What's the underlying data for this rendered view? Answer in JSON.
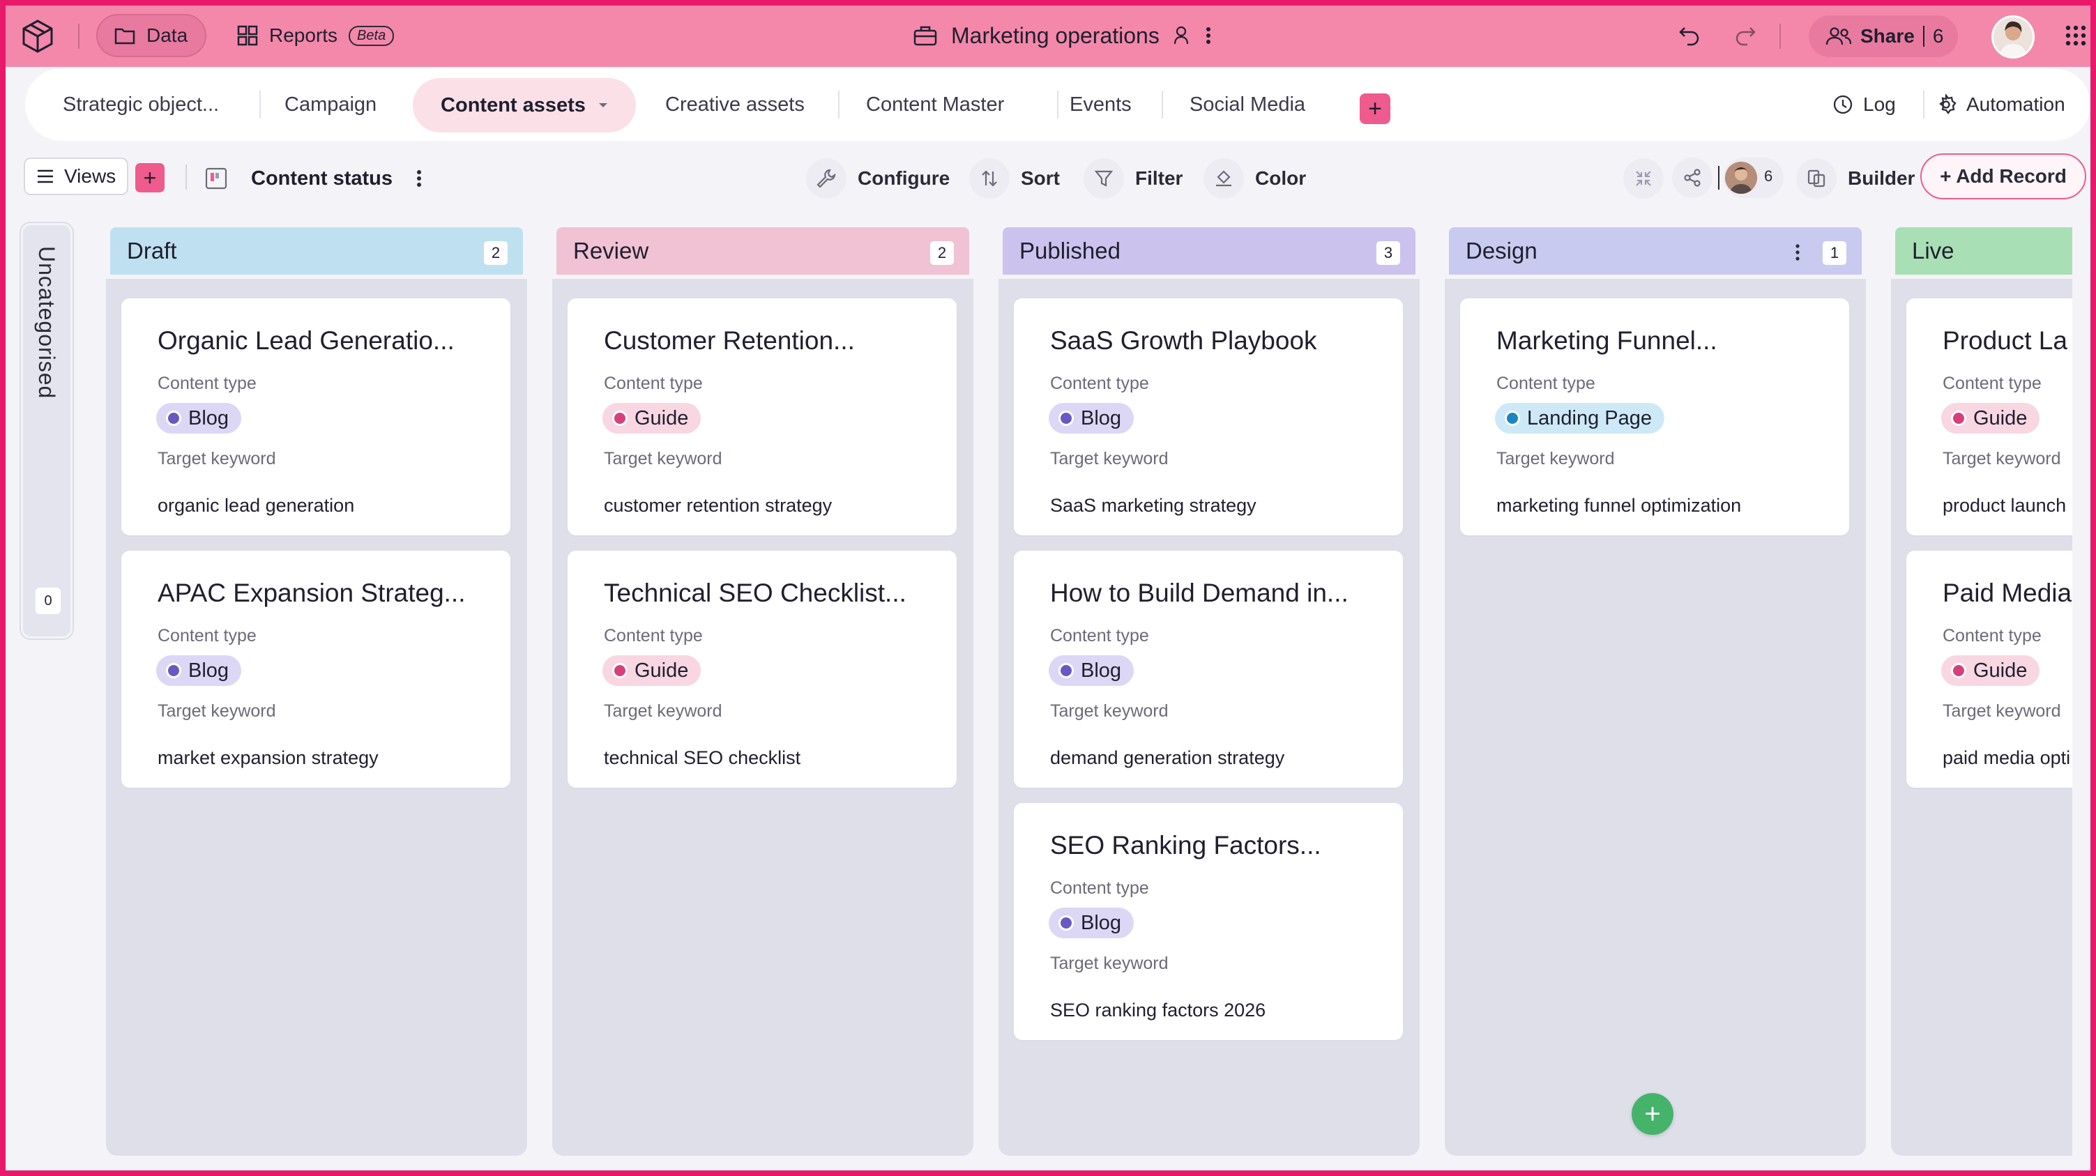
{
  "topbar": {
    "data_label": "Data",
    "reports_label": "Reports",
    "beta_label": "Beta",
    "title": "Marketing operations",
    "share_label": "Share",
    "share_count": "6"
  },
  "tabs": {
    "items": [
      "Strategic object...",
      "Campaign",
      "Content assets",
      "Creative assets",
      "Content Master",
      "Events",
      "Social Media"
    ],
    "active": "Content assets",
    "log_label": "Log",
    "automation_label": "Automation"
  },
  "toolbar": {
    "views_label": "Views",
    "view_name": "Content status",
    "configure_label": "Configure",
    "sort_label": "Sort",
    "filter_label": "Filter",
    "color_label": "Color",
    "collaborator_count": "6",
    "builder_label": "Builder",
    "add_record_label": "+ Add Record"
  },
  "uncategorised": {
    "label": "Uncategorised",
    "count": "0"
  },
  "colors": {
    "accent": "#ef5b8c",
    "topbar": "#f488aa",
    "frame": "#e8196a",
    "draft": "#bfe0f0",
    "review": "#f0c2d4",
    "published": "#cbc3ee",
    "design": "#c8caf0",
    "live": "#a9dfb4",
    "blog_pill": "#dcd7f5",
    "guide_pill": "#f8d6e2",
    "landing_pill": "#cde9f7"
  },
  "columns": [
    {
      "title": "Draft",
      "count": "2",
      "cards": [
        {
          "title": "Organic Lead Generatio...",
          "type_label": "Content type",
          "type": "Blog",
          "kw_label": "Target keyword",
          "keyword": "organic lead generation"
        },
        {
          "title": "APAC Expansion Strateg...",
          "type_label": "Content type",
          "type": "Blog",
          "kw_label": "Target keyword",
          "keyword": "market expansion strategy"
        }
      ]
    },
    {
      "title": "Review",
      "count": "2",
      "cards": [
        {
          "title": "Customer Retention...",
          "type_label": "Content type",
          "type": "Guide",
          "kw_label": "Target keyword",
          "keyword": "customer retention strategy"
        },
        {
          "title": "Technical SEO Checklist...",
          "type_label": "Content type",
          "type": "Guide",
          "kw_label": "Target keyword",
          "keyword": "technical SEO checklist"
        }
      ]
    },
    {
      "title": "Published",
      "count": "3",
      "cards": [
        {
          "title": "SaaS Growth Playbook",
          "type_label": "Content type",
          "type": "Blog",
          "kw_label": "Target keyword",
          "keyword": "SaaS marketing strategy"
        },
        {
          "title": "How to Build Demand in...",
          "type_label": "Content type",
          "type": "Blog",
          "kw_label": "Target keyword",
          "keyword": "demand generation strategy"
        },
        {
          "title": "SEO Ranking Factors...",
          "type_label": "Content type",
          "type": "Blog",
          "kw_label": "Target keyword",
          "keyword": "SEO ranking factors 2026"
        }
      ]
    },
    {
      "title": "Design",
      "count": "1",
      "cards": [
        {
          "title": "Marketing Funnel...",
          "type_label": "Content type",
          "type": "Landing Page",
          "kw_label": "Target keyword",
          "keyword": "marketing funnel optimization"
        }
      ]
    },
    {
      "title": "Live",
      "cards": [
        {
          "title": "Product La",
          "type_label": "Content type",
          "type": "Guide",
          "kw_label": "Target keyword",
          "keyword": "product launch"
        },
        {
          "title": "Paid Media",
          "type_label": "Content type",
          "type": "Guide",
          "kw_label": "Target keyword",
          "keyword": "paid media opti"
        }
      ]
    }
  ]
}
